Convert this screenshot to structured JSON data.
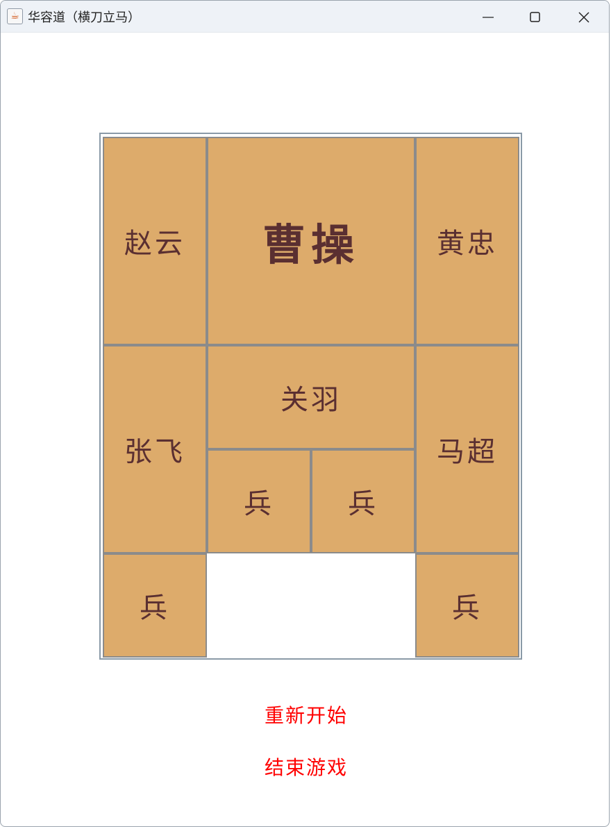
{
  "window": {
    "title": "华容道（横刀立马）"
  },
  "board": {
    "pieces": {
      "zhaoyun": "赵云",
      "caocao": "曹操",
      "huangzhong": "黄忠",
      "zhangfei": "张飞",
      "guanyu": "关羽",
      "machao": "马超",
      "soldier1": "兵",
      "soldier2": "兵",
      "soldier3": "兵",
      "soldier4": "兵"
    },
    "piece_color": "#ddab6b",
    "text_color": "#5a2f31"
  },
  "menu": {
    "restart": "重新开始",
    "quit": "结束游戏",
    "color": "#ff0000"
  }
}
